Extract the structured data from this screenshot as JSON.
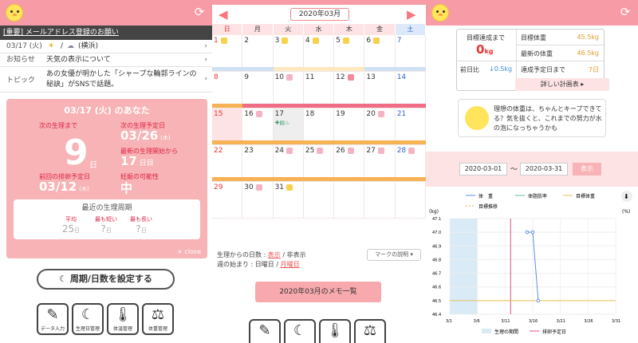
{
  "p1": {
    "notice": "[重要] メールアドレス登録のお願い",
    "weather_date": "03/17 (火)",
    "weather_place": "(横浜)",
    "news_label": "お知らせ",
    "news_value": "天気の表示について",
    "topic_label": "トピック",
    "topic_value": "あの女優が明かした「シャープな輪郭ラインの秘訣」がSNSで話題。",
    "card_title": "03/17 (火) のあなた",
    "next_period_label": "次の生理まで",
    "next_period_days": "9",
    "next_period_unit": "日",
    "next_expected_label": "次の生理予定日",
    "next_expected_value": "03/26",
    "next_expected_dow": "(木)",
    "since_start_label": "最新の生理開始から",
    "since_start_value": "17",
    "since_start_unit": "日目",
    "ovulation_label": "前回の排卵予定日",
    "ovulation_value": "03/12",
    "ovulation_dow": "(木)",
    "pregnancy_label": "妊娠の可能性",
    "pregnancy_value": "中",
    "cycle_title": "最近の生理周期",
    "avg_label": "平均",
    "avg_value": "25",
    "short_label": "最も短い",
    "short_value": "?",
    "long_label": "最も長い",
    "long_value": "?",
    "day_unit": "日",
    "close": "close",
    "set_button": "周期/日数を設定する",
    "icons": [
      "データ入力",
      "生理日管理",
      "体温管理",
      "体重管理"
    ]
  },
  "p2": {
    "month": "2020年03月",
    "dows": [
      "日",
      "月",
      "火",
      "水",
      "木",
      "金",
      "土"
    ],
    "weeks": [
      [
        "1",
        "2",
        "3",
        "4",
        "5",
        "6",
        "7"
      ],
      [
        "8",
        "9",
        "10",
        "11",
        "12",
        "13",
        "14"
      ],
      [
        "15",
        "16",
        "17",
        "18",
        "19",
        "20",
        "21"
      ],
      [
        "22",
        "23",
        "24",
        "25",
        "26",
        "27",
        "28"
      ],
      [
        "29",
        "30",
        "31",
        "",
        "",
        "",
        ""
      ]
    ],
    "days_label": "生理からの日数 :",
    "days_show": "表示",
    "days_hide": "/ 非表示",
    "week_start_label": "週の始まり :",
    "week_start_sun": "日曜日",
    "week_start_mon": "月曜日",
    "mark_button": "マークの説明",
    "memo_button": "2020年03月のメモ一覧"
  },
  "p3": {
    "goal_label": "目標達成まで",
    "goal_value": "0",
    "goal_unit": "kg",
    "target_label": "目標体重",
    "target_value": "45.5kg",
    "latest_label": "最新の体重",
    "latest_value": "46.5kg",
    "prev_label": "前日比",
    "prev_value": "↓0.5kg",
    "schedule_label": "達成予定日まで",
    "schedule_value": "7日",
    "plan_button": "詳しい計画表",
    "bubble_text": "理想の体重は、ちゃんとキープできてる？気を抜くと、これまでの努力が水の泡になっちゃうかも",
    "date_from": "2020-03-01",
    "date_to": "2020-03-31",
    "tilde": "〜",
    "show_button": "表示",
    "legend_weight": "体　重",
    "legend_fat": "体脂肪率",
    "legend_target": "目標体重",
    "legend_trend": "目標推移",
    "unit_kg": "(kg)",
    "unit_pct": "(%)",
    "legend_period": "生理の期間",
    "legend_ovulation": "排卵予定日"
  },
  "chart_data": {
    "type": "line",
    "x": [
      "3/1",
      "3/6",
      "3/11",
      "3/16",
      "3/21",
      "3/26",
      "3/31"
    ],
    "yticks": [
      "47.1",
      "47.0",
      "46.9",
      "46.8",
      "46.7",
      "46.6",
      "46.5",
      "46.4"
    ],
    "ylim": [
      46.4,
      47.1
    ],
    "series": [
      {
        "name": "体　重",
        "values": [
          {
            "x": "3/15",
            "y": 47.0
          },
          {
            "x": "3/16",
            "y": 47.0
          },
          {
            "x": "3/17",
            "y": 46.5
          }
        ]
      }
    ],
    "target": 46.5,
    "period_range": [
      "3/1",
      "3/6"
    ],
    "ovulation": "3/12"
  }
}
